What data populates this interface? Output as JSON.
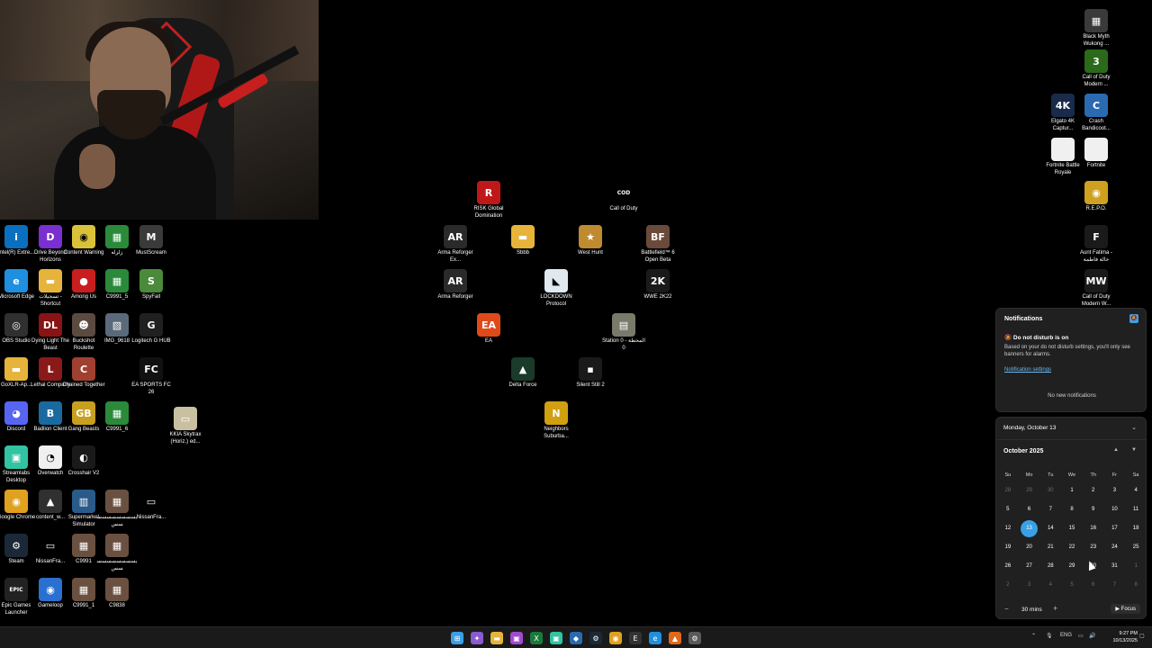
{
  "desktop_icons": [
    {
      "label": "Intel(R) Extre...",
      "icon": "intel-app-icon",
      "color": "#0a6fbf",
      "glyph": "i"
    },
    {
      "label": "Drive Beyond Horizons",
      "icon": "drive-beyond-horizons-icon",
      "color": "#7a2fd0",
      "glyph": "D"
    },
    {
      "label": "Content Warning",
      "icon": "content-warning-icon",
      "color": "#d9c23a",
      "glyph": "◉"
    },
    {
      "label": "زلزله",
      "icon": "game-tile-icon",
      "color": "#2a8a3a",
      "glyph": "▦"
    },
    {
      "label": "MustScream",
      "icon": "mustscream-icon",
      "color": "#3a3a3a",
      "glyph": "M"
    },
    {
      "label": "Microsoft Edge",
      "icon": "edge-icon",
      "color": "#1f8fe0",
      "glyph": "e"
    },
    {
      "label": "تسجيلات - Shortcut",
      "icon": "folder-icon",
      "color": "#e6b43a",
      "glyph": "▬"
    },
    {
      "label": "Among Us",
      "icon": "among-us-icon",
      "color": "#c81e1e",
      "glyph": "●"
    },
    {
      "label": "C9991_5",
      "icon": "game-tile-icon",
      "color": "#2a8a3a",
      "glyph": "▦"
    },
    {
      "label": "SpyFall",
      "icon": "spyfall-icon",
      "color": "#4a8a3a",
      "glyph": "S"
    },
    {
      "label": "OBS Studio",
      "icon": "obs-icon",
      "color": "#303030",
      "glyph": "◎"
    },
    {
      "label": "Dying Light The Beast",
      "icon": "dying-light-icon",
      "color": "#8a1414",
      "glyph": "DL"
    },
    {
      "label": "Buckshot Roulette",
      "icon": "buckshot-roulette-icon",
      "color": "#5a4a40",
      "glyph": "☻"
    },
    {
      "label": "IMG_9618",
      "icon": "image-file-icon",
      "color": "#5a6a7a",
      "glyph": "▧"
    },
    {
      "label": "Logitech G HUB",
      "icon": "logitech-icon",
      "color": "#202020",
      "glyph": "G"
    },
    {
      "label": "GoXLR-Ap...",
      "icon": "folder-icon",
      "color": "#e6b43a",
      "glyph": "▬"
    },
    {
      "label": "Lethal Company",
      "icon": "lethal-company-icon",
      "color": "#8a1a1a",
      "glyph": "L"
    },
    {
      "label": "Chained Together",
      "icon": "chained-together-icon",
      "color": "#a04030",
      "glyph": "C"
    },
    {
      "label": "EA SPORTS FC 26",
      "icon": "ea-fc-icon",
      "color": "#111111",
      "glyph": "FC"
    },
    {
      "label": "Discord",
      "icon": "discord-icon",
      "color": "#5865f2",
      "glyph": "◕"
    },
    {
      "label": "Badlion Client",
      "icon": "badlion-icon",
      "color": "#1a6aa0",
      "glyph": "B"
    },
    {
      "label": "Gang Beasts",
      "icon": "gang-beasts-icon",
      "color": "#c8a020",
      "glyph": "GB"
    },
    {
      "label": "C9991_6",
      "icon": "game-tile-icon",
      "color": "#2a8a3a",
      "glyph": "▦"
    },
    {
      "label": "KKIA Skytrax (Horiz.) ed...",
      "icon": "image-file-icon",
      "color": "#c8c0a0",
      "glyph": "▭"
    },
    {
      "label": "Streamlabs Desktop",
      "icon": "streamlabs-icon",
      "color": "#31c3a2",
      "glyph": "▣"
    },
    {
      "label": "Overwatch",
      "icon": "overwatch-icon",
      "color": "#f0f0f0",
      "glyph": "◔"
    },
    {
      "label": "Crosshair V2",
      "icon": "crosshair-icon",
      "color": "#1a1a1a",
      "glyph": "◐"
    },
    {
      "label": "Google Chrome",
      "icon": "chrome-icon",
      "color": "#e0a020",
      "glyph": "◉"
    },
    {
      "label": "content_w...",
      "icon": "content-warning-file-icon",
      "color": "#303030",
      "glyph": "▲"
    },
    {
      "label": "Supermarket Simulator",
      "icon": "supermarket-simulator-icon",
      "color": "#2a5a8a",
      "glyph": "▥"
    },
    {
      "label": "يسسسسسسسسسس",
      "icon": "video-file-icon",
      "color": "#6a5040",
      "glyph": "▦"
    },
    {
      "label": "NissanFra...",
      "icon": "blank-file-icon",
      "color": "#000000",
      "glyph": "▭"
    },
    {
      "label": "Steam",
      "icon": "steam-icon",
      "color": "#1b2838",
      "glyph": "⚙"
    },
    {
      "label": "NissanFra...",
      "icon": "blank-file-icon",
      "color": "#000000",
      "glyph": "▭"
    },
    {
      "label": "C9991",
      "icon": "video-file-icon",
      "color": "#6a5040",
      "glyph": "▦"
    },
    {
      "label": "يسسسسسسسسسس",
      "icon": "video-file-icon",
      "color": "#6a5040",
      "glyph": "▦"
    },
    {
      "label": "Epic Games Launcher",
      "icon": "epic-games-icon",
      "color": "#222222",
      "glyph": "EPIC"
    },
    {
      "label": "Gameloop",
      "icon": "gameloop-icon",
      "color": "#2a70d0",
      "glyph": "◉"
    },
    {
      "label": "C9991_1",
      "icon": "video-file-icon",
      "color": "#6a5040",
      "glyph": "▦"
    },
    {
      "label": "C9838",
      "icon": "video-file-icon",
      "color": "#6a5040",
      "glyph": "▦"
    },
    {
      "label": "RISK Global Domination",
      "icon": "risk-icon",
      "color": "#c01818",
      "glyph": "R"
    },
    {
      "label": "Call of Duty",
      "icon": "call-of-duty-icon",
      "color": "#000000",
      "glyph": "COD"
    },
    {
      "label": "Arma Reforger Ex...",
      "icon": "arma-reforger-icon",
      "color": "#2a2a2a",
      "glyph": "AR"
    },
    {
      "label": "Sbbb",
      "icon": "folder-icon",
      "color": "#e6b43a",
      "glyph": "▬"
    },
    {
      "label": "West Hunt",
      "icon": "west-hunt-icon",
      "color": "#c08a30",
      "glyph": "★"
    },
    {
      "label": "Battlefield™ 6 Open Beta",
      "icon": "battlefield-icon",
      "color": "#6a4a3a",
      "glyph": "BF"
    },
    {
      "label": "Arma Reforger",
      "icon": "arma-reforger-icon",
      "color": "#2a2a2a",
      "glyph": "AR"
    },
    {
      "label": "LOCKDOWN Protocol",
      "icon": "lockdown-protocol-icon",
      "color": "#e0e8f0",
      "glyph": "◣"
    },
    {
      "label": "WWE 2K22",
      "icon": "wwe-icon",
      "color": "#1a1a1a",
      "glyph": "2K"
    },
    {
      "label": "EA",
      "icon": "ea-icon",
      "color": "#e04a1a",
      "glyph": "EA"
    },
    {
      "label": "Station 0 - المحطة 0",
      "icon": "station-zero-icon",
      "color": "#7a7a6a",
      "glyph": "▤"
    },
    {
      "label": "Delta Force",
      "icon": "delta-force-icon",
      "color": "#1a3a2a",
      "glyph": "▲"
    },
    {
      "label": "Silent Still 2",
      "icon": "silent-still-icon",
      "color": "#1a1a1a",
      "glyph": "▪"
    },
    {
      "label": "Neighbors Suburba...",
      "icon": "neighbors-icon",
      "color": "#d0a010",
      "glyph": "N"
    },
    {
      "label": "Black Myth Wukong ...",
      "icon": "black-myth-wukong-icon",
      "color": "#3a3a3a",
      "glyph": "▦"
    },
    {
      "label": "Call of Duty Modern ...",
      "icon": "call-of-duty-mw3-icon",
      "color": "#2a6a1a",
      "glyph": "3"
    },
    {
      "label": "Elgato 4K Captur...",
      "icon": "elgato-icon",
      "color": "#1a2a4a",
      "glyph": "4K"
    },
    {
      "label": "Crash Bandicoot...",
      "icon": "crash-bandicoot-icon",
      "color": "#2a6ab0",
      "glyph": "C"
    },
    {
      "label": "Fortnite Battle Royale",
      "icon": "blank-file-icon",
      "color": "#f0f0f0",
      "glyph": ""
    },
    {
      "label": "Fortnite",
      "icon": "blank-file-icon",
      "color": "#f0f0f0",
      "glyph": ""
    },
    {
      "label": "R.E.P.O.",
      "icon": "repo-icon",
      "color": "#d0a020",
      "glyph": "◉"
    },
    {
      "label": "Aunt Fatima - خالة فاطمة",
      "icon": "aunt-fatima-icon",
      "color": "#1a1a1a",
      "glyph": "F"
    },
    {
      "label": "Call of Duty Modern W...",
      "icon": "call-of-duty-mw-icon",
      "color": "#1a1a1a",
      "glyph": "MW"
    }
  ],
  "notifications": {
    "title": "Notifications",
    "dnd_title": "Do not disturb is on",
    "dnd_description": "Based on your do not disturb settings, you'll only see banners for alarms.",
    "settings_link": "Notification settings",
    "empty_text": "No new notifications"
  },
  "calendar": {
    "date_heading": "Monday, October 13",
    "month_label": "October 2025",
    "weekdays": [
      "Su",
      "Mo",
      "Tu",
      "We",
      "Th",
      "Fr",
      "Sa"
    ],
    "days": [
      {
        "d": "28",
        "dim": true
      },
      {
        "d": "29",
        "dim": true
      },
      {
        "d": "30",
        "dim": true
      },
      {
        "d": "1"
      },
      {
        "d": "2"
      },
      {
        "d": "3"
      },
      {
        "d": "4"
      },
      {
        "d": "5"
      },
      {
        "d": "6"
      },
      {
        "d": "7"
      },
      {
        "d": "8"
      },
      {
        "d": "9"
      },
      {
        "d": "10"
      },
      {
        "d": "11"
      },
      {
        "d": "12"
      },
      {
        "d": "13",
        "today": true
      },
      {
        "d": "14"
      },
      {
        "d": "15"
      },
      {
        "d": "16"
      },
      {
        "d": "17"
      },
      {
        "d": "18"
      },
      {
        "d": "19"
      },
      {
        "d": "20"
      },
      {
        "d": "21"
      },
      {
        "d": "22"
      },
      {
        "d": "23"
      },
      {
        "d": "24"
      },
      {
        "d": "25"
      },
      {
        "d": "26"
      },
      {
        "d": "27"
      },
      {
        "d": "28"
      },
      {
        "d": "29"
      },
      {
        "d": "30"
      },
      {
        "d": "31"
      },
      {
        "d": "1",
        "dim": true
      },
      {
        "d": "2",
        "dim": true
      },
      {
        "d": "3",
        "dim": true
      },
      {
        "d": "4",
        "dim": true
      },
      {
        "d": "5",
        "dim": true
      },
      {
        "d": "6",
        "dim": true
      },
      {
        "d": "7",
        "dim": true
      },
      {
        "d": "8",
        "dim": true
      }
    ],
    "focus_minutes": "30 mins",
    "focus_label": "Focus"
  },
  "taskbar": {
    "apps": [
      {
        "name": "start-icon",
        "color": "#3aa0e6",
        "glyph": "⊞"
      },
      {
        "name": "copilot-icon",
        "color": "#8a5ad0",
        "glyph": "✦"
      },
      {
        "name": "taskbar-app-icon",
        "color": "#a04ad0",
        "glyph": "▣"
      },
      {
        "name": "file-explorer-icon",
        "color": "#e6b43a",
        "glyph": "▬"
      },
      {
        "name": "excel-icon",
        "color": "#1a7a3a",
        "glyph": "X"
      },
      {
        "name": "streamlabs-icon",
        "color": "#31c3a2",
        "glyph": "▣"
      },
      {
        "name": "app-icon",
        "color": "#2a6ab0",
        "glyph": "◆"
      },
      {
        "name": "steam-icon",
        "color": "#1b2838",
        "glyph": "⚙"
      },
      {
        "name": "chrome-icon",
        "color": "#e0a020",
        "glyph": "◉"
      },
      {
        "name": "epic-games-icon",
        "color": "#333333",
        "glyph": "E"
      },
      {
        "name": "edge-icon",
        "color": "#1f8fe0",
        "glyph": "e"
      },
      {
        "name": "app-icon",
        "color": "#e06a1a",
        "glyph": "▲"
      },
      {
        "name": "settings-icon",
        "color": "#5a5a5a",
        "glyph": "⚙"
      }
    ],
    "language": "ENG",
    "time": "9:27 PM",
    "date": "10/13/2025"
  }
}
